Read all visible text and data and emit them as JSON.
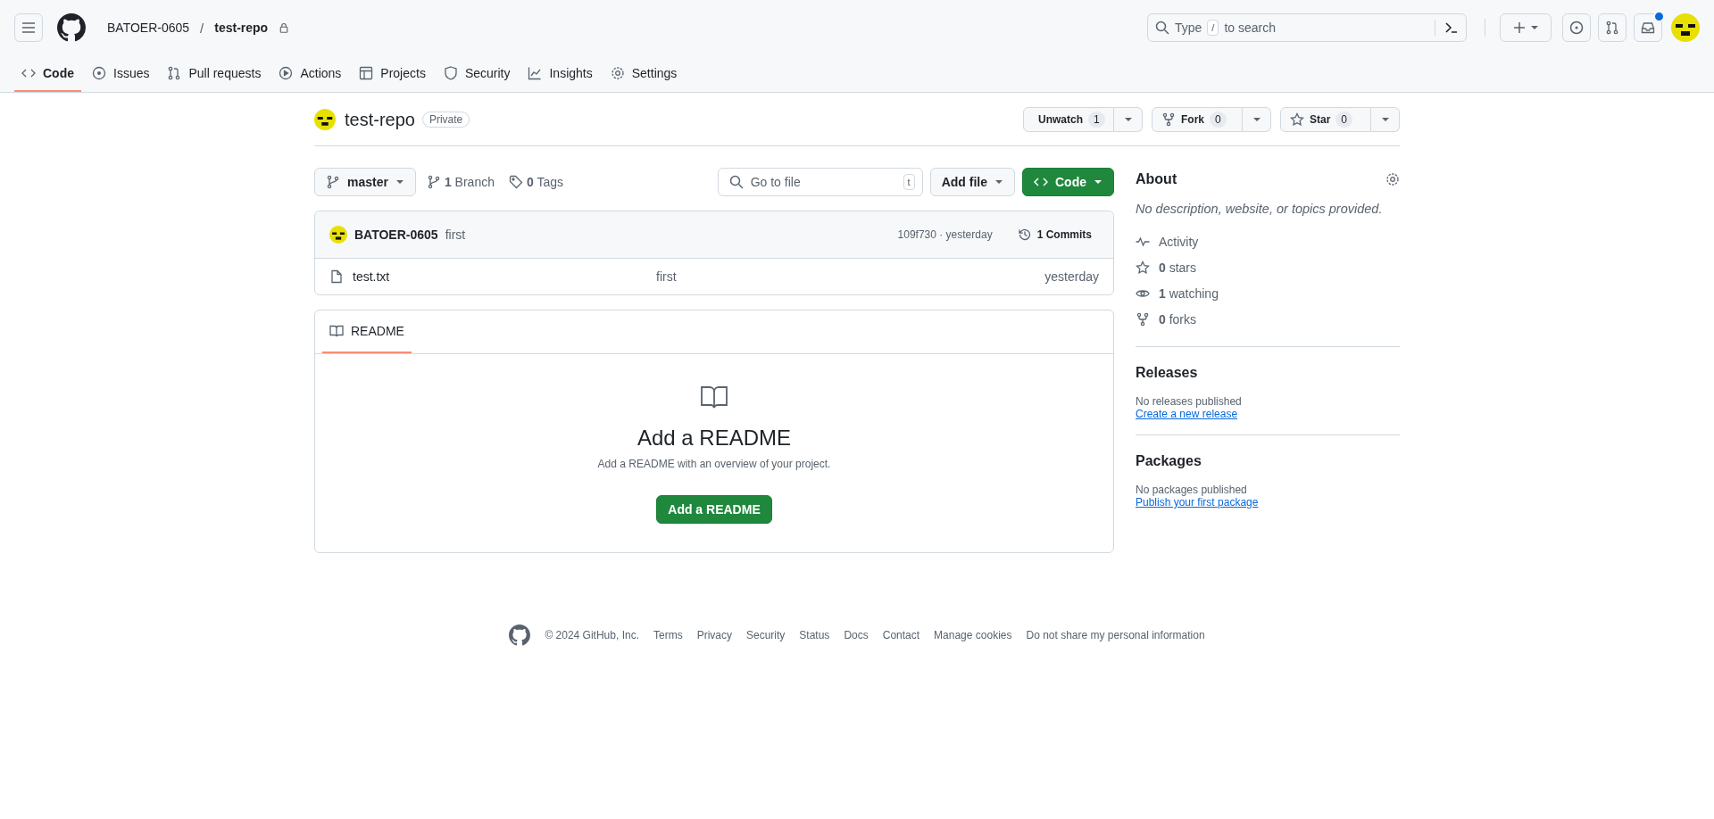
{
  "header": {
    "owner": "BATOER-0605",
    "separator": "/",
    "repo": "test-repo",
    "search_placeholder_before": "Type",
    "search_key": "/",
    "search_placeholder_after": "to search",
    "inbox_unread": true
  },
  "nav_tabs": [
    {
      "label": "Code",
      "kind": "code",
      "selected": true
    },
    {
      "label": "Issues",
      "kind": "issues",
      "selected": false
    },
    {
      "label": "Pull requests",
      "kind": "pulls",
      "selected": false
    },
    {
      "label": "Actions",
      "kind": "actions",
      "selected": false
    },
    {
      "label": "Projects",
      "kind": "projects",
      "selected": false
    },
    {
      "label": "Security",
      "kind": "security",
      "selected": false
    },
    {
      "label": "Insights",
      "kind": "insights",
      "selected": false
    },
    {
      "label": "Settings",
      "kind": "settings",
      "selected": false
    }
  ],
  "repo": {
    "name": "test-repo",
    "visibility": "Private",
    "actions": [
      {
        "label": "Unwatch",
        "kind": "watch",
        "count": "1"
      },
      {
        "label": "Fork",
        "kind": "fork",
        "count": "0"
      },
      {
        "label": "Star",
        "kind": "star",
        "count": "0"
      }
    ]
  },
  "toolbar": {
    "branch": "master",
    "branches": "**1** Branch",
    "tags": "**0** Tags",
    "go_to_file_placeholder": "Go to file",
    "go_to_file_key": "t",
    "add_file": "Add file",
    "code": "Code"
  },
  "commit": {
    "author": "BATOER-0605",
    "message": "first",
    "hash_time": "109f730 · yesterday",
    "commits": "1 Commits"
  },
  "files": [
    {
      "name": "test.txt",
      "message": "first",
      "time": "yesterday"
    }
  ],
  "readme": {
    "tab": "README",
    "title": "Add a README",
    "description": "Add a README with an overview of your project.",
    "button": "Add a README"
  },
  "about": {
    "title": "About",
    "description": "No description, website, or topics provided.",
    "stats": [
      {
        "kind": "activity",
        "text": "Activity"
      },
      {
        "kind": "stars",
        "text": "**0** stars"
      },
      {
        "kind": "watching",
        "text": "**1** watching"
      },
      {
        "kind": "forks",
        "text": "**0** forks"
      }
    ]
  },
  "releases": {
    "title": "Releases",
    "text": "No releases published",
    "link": "Create a new release"
  },
  "packages": {
    "title": "Packages",
    "text": "No packages published",
    "link": "Publish your first package"
  },
  "footer": {
    "copyright": "© 2024 GitHub, Inc.",
    "links": [
      "Terms",
      "Privacy",
      "Security",
      "Status",
      "Docs",
      "Contact",
      "Manage cookies",
      "Do not share my personal information"
    ]
  }
}
